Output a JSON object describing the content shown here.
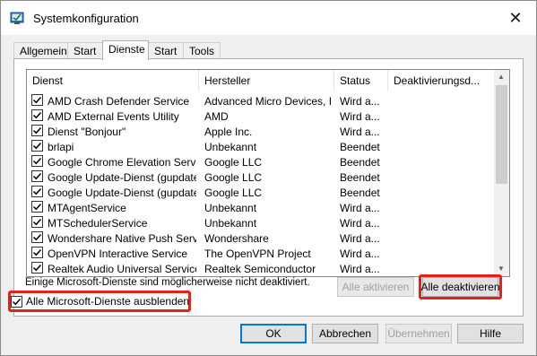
{
  "window": {
    "title": "Systemkonfiguration",
    "close_icon": "close-icon"
  },
  "tabs": [
    {
      "label": "Allgemein"
    },
    {
      "label": "Start"
    },
    {
      "label": "Dienste",
      "active": true
    },
    {
      "label": "Start"
    },
    {
      "label": "Tools"
    }
  ],
  "table": {
    "columns": [
      "Dienst",
      "Hersteller",
      "Status",
      "Deaktivierungsd..."
    ],
    "rows": [
      {
        "checked": true,
        "name": "AMD Crash Defender Service",
        "vendor": "Advanced Micro Devices, I...",
        "status": "Wird a...",
        "date": ""
      },
      {
        "checked": true,
        "name": "AMD External Events Utility",
        "vendor": "AMD",
        "status": "Wird a...",
        "date": ""
      },
      {
        "checked": true,
        "name": "Dienst \"Bonjour\"",
        "vendor": "Apple Inc.",
        "status": "Wird a...",
        "date": ""
      },
      {
        "checked": true,
        "name": "brlapi",
        "vendor": "Unbekannt",
        "status": "Beendet",
        "date": ""
      },
      {
        "checked": true,
        "name": "Google Chrome Elevation Servic...",
        "vendor": "Google LLC",
        "status": "Beendet",
        "date": ""
      },
      {
        "checked": true,
        "name": "Google Update-Dienst (gupdate)",
        "vendor": "Google LLC",
        "status": "Beendet",
        "date": ""
      },
      {
        "checked": true,
        "name": "Google Update-Dienst (gupdatem)",
        "vendor": "Google LLC",
        "status": "Beendet",
        "date": ""
      },
      {
        "checked": true,
        "name": "MTAgentService",
        "vendor": "Unbekannt",
        "status": "Wird a...",
        "date": ""
      },
      {
        "checked": true,
        "name": "MTSchedulerService",
        "vendor": "Unbekannt",
        "status": "Wird a...",
        "date": ""
      },
      {
        "checked": true,
        "name": "Wondershare Native Push Service",
        "vendor": "Wondershare",
        "status": "Wird a...",
        "date": ""
      },
      {
        "checked": true,
        "name": "OpenVPN Interactive Service",
        "vendor": "The OpenVPN Project",
        "status": "Wird a...",
        "date": ""
      },
      {
        "checked": true,
        "name": "Realtek Audio Universal Service",
        "vendor": "Realtek Semiconductor",
        "status": "Wird a...",
        "date": ""
      }
    ]
  },
  "note": "Einige Microsoft-Dienste sind möglicherweise nicht deaktiviert.",
  "buttons": {
    "enable_all": "Alle aktivieren",
    "disable_all": "Alle deaktivieren",
    "ok": "OK",
    "cancel": "Abbrechen",
    "apply": "Übernehmen",
    "help": "Hilfe"
  },
  "hide_ms": {
    "label": "Alle Microsoft-Dienste ausblenden",
    "checked": true
  },
  "colors": {
    "highlight": "#e2231a",
    "default_button_border": "#0078d7"
  }
}
